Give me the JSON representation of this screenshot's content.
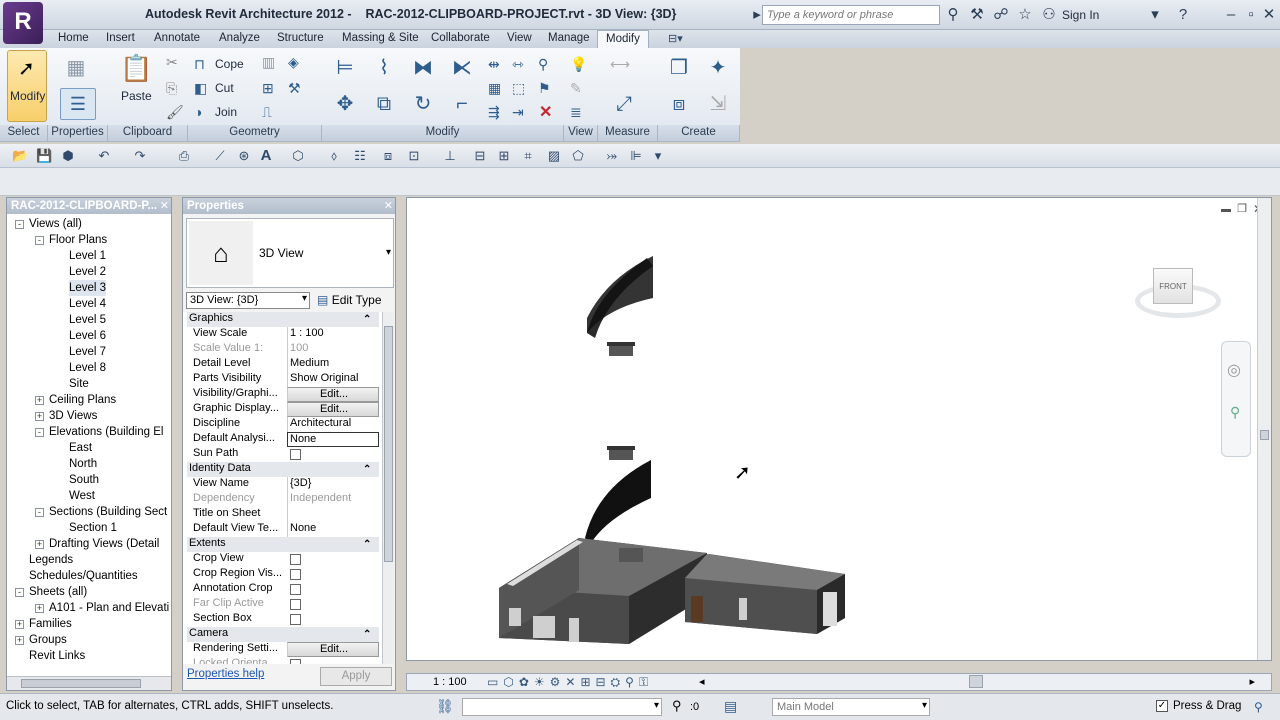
{
  "window": {
    "app_name": "Autodesk Revit Architecture 2012 -",
    "document": "RAC-2012-CLIPBOARD-PROJECT.rvt - 3D View: {3D}",
    "logo_letter": "R",
    "search_placeholder": "Type a keyword or phrase",
    "sign_in": "Sign In"
  },
  "tabs": [
    "Home",
    "Insert",
    "Annotate",
    "Analyze",
    "Structure",
    "Massing & Site",
    "Collaborate",
    "View",
    "Manage",
    "Modify"
  ],
  "active_tab": "Modify",
  "ribbon": {
    "select_panel": "Select",
    "properties_panel": "Properties",
    "clipboard_panel": "Clipboard",
    "geometry_panel": "Geometry",
    "modify_panel": "Modify",
    "view_panel": "View",
    "measure_panel": "Measure",
    "create_panel": "Create",
    "modify_btn": "Modify",
    "paste_btn": "Paste",
    "cope_btn": "Cope",
    "cut_btn": "Cut",
    "join_btn": "Join"
  },
  "browser": {
    "title": "RAC-2012-CLIPBOARD-P...",
    "items": [
      {
        "label": "Views (all)",
        "level": 0,
        "exp": "-"
      },
      {
        "label": "Floor Plans",
        "level": 1,
        "exp": "-"
      },
      {
        "label": "Level 1",
        "level": 2
      },
      {
        "label": "Level 2",
        "level": 2
      },
      {
        "label": "Level 3",
        "level": 2,
        "selected": true
      },
      {
        "label": "Level 4",
        "level": 2
      },
      {
        "label": "Level 5",
        "level": 2
      },
      {
        "label": "Level 6",
        "level": 2
      },
      {
        "label": "Level 7",
        "level": 2
      },
      {
        "label": "Level 8",
        "level": 2
      },
      {
        "label": "Site",
        "level": 2
      },
      {
        "label": "Ceiling Plans",
        "level": 1,
        "exp": "+"
      },
      {
        "label": "3D Views",
        "level": 1,
        "exp": "+"
      },
      {
        "label": "Elevations (Building El",
        "level": 1,
        "exp": "-"
      },
      {
        "label": "East",
        "level": 2
      },
      {
        "label": "North",
        "level": 2
      },
      {
        "label": "South",
        "level": 2
      },
      {
        "label": "West",
        "level": 2
      },
      {
        "label": "Sections (Building Sect",
        "level": 1,
        "exp": "-"
      },
      {
        "label": "Section 1",
        "level": 2
      },
      {
        "label": "Drafting Views (Detail",
        "level": 1,
        "exp": "+"
      },
      {
        "label": "Legends",
        "level": 0
      },
      {
        "label": "Schedules/Quantities",
        "level": 0
      },
      {
        "label": "Sheets (all)",
        "level": 0,
        "exp": "-"
      },
      {
        "label": "A101 - Plan and Elevati",
        "level": 1,
        "exp": "+"
      },
      {
        "label": "Families",
        "level": 0,
        "exp": "+"
      },
      {
        "label": "Groups",
        "level": 0,
        "exp": "+"
      },
      {
        "label": "Revit Links",
        "level": 0
      }
    ]
  },
  "properties": {
    "title": "Properties",
    "type_name": "3D View",
    "view_selector": "3D View: {3D}",
    "edit_type": "Edit Type",
    "help": "Properties help",
    "apply": "Apply",
    "rows": [
      {
        "group": "Graphics"
      },
      {
        "k": "View Scale",
        "v": "1 : 100"
      },
      {
        "k": "Scale Value    1:",
        "v": "100",
        "dim": true
      },
      {
        "k": "Detail Level",
        "v": "Medium"
      },
      {
        "k": "Parts Visibility",
        "v": "Show Original"
      },
      {
        "k": "Visibility/Graphi...",
        "v": "Edit...",
        "btn": true
      },
      {
        "k": "Graphic Display...",
        "v": "Edit...",
        "btn": true
      },
      {
        "k": "Discipline",
        "v": "Architectural"
      },
      {
        "k": "Default Analysi...",
        "v": "None",
        "boxed": true
      },
      {
        "k": "Sun Path",
        "cb": true
      },
      {
        "group": "Identity Data"
      },
      {
        "k": "View Name",
        "v": "{3D}"
      },
      {
        "k": "Dependency",
        "v": "Independent",
        "dim": true
      },
      {
        "k": "Title on Sheet",
        "v": ""
      },
      {
        "k": "Default View Te...",
        "v": "None"
      },
      {
        "group": "Extents"
      },
      {
        "k": "Crop View",
        "cb": true
      },
      {
        "k": "Crop Region Vis...",
        "cb": true
      },
      {
        "k": "Annotation Crop",
        "cb": true
      },
      {
        "k": "Far Clip Active",
        "cb": true,
        "dim": true
      },
      {
        "k": "Section Box",
        "cb": true
      },
      {
        "group": "Camera"
      },
      {
        "k": "Rendering Setti...",
        "v": "Edit...",
        "btn": true
      },
      {
        "k": "Locked Orienta...",
        "cb": true,
        "dim": true
      }
    ]
  },
  "viewport": {
    "viewcube_face": "FRONT",
    "scale": "1 : 100"
  },
  "status": {
    "hint": "Click to select, TAB for alternates, CTRL adds, SHIFT unselects.",
    "count": ":0",
    "model": "Main Model",
    "press_drag": "Press & Drag"
  }
}
